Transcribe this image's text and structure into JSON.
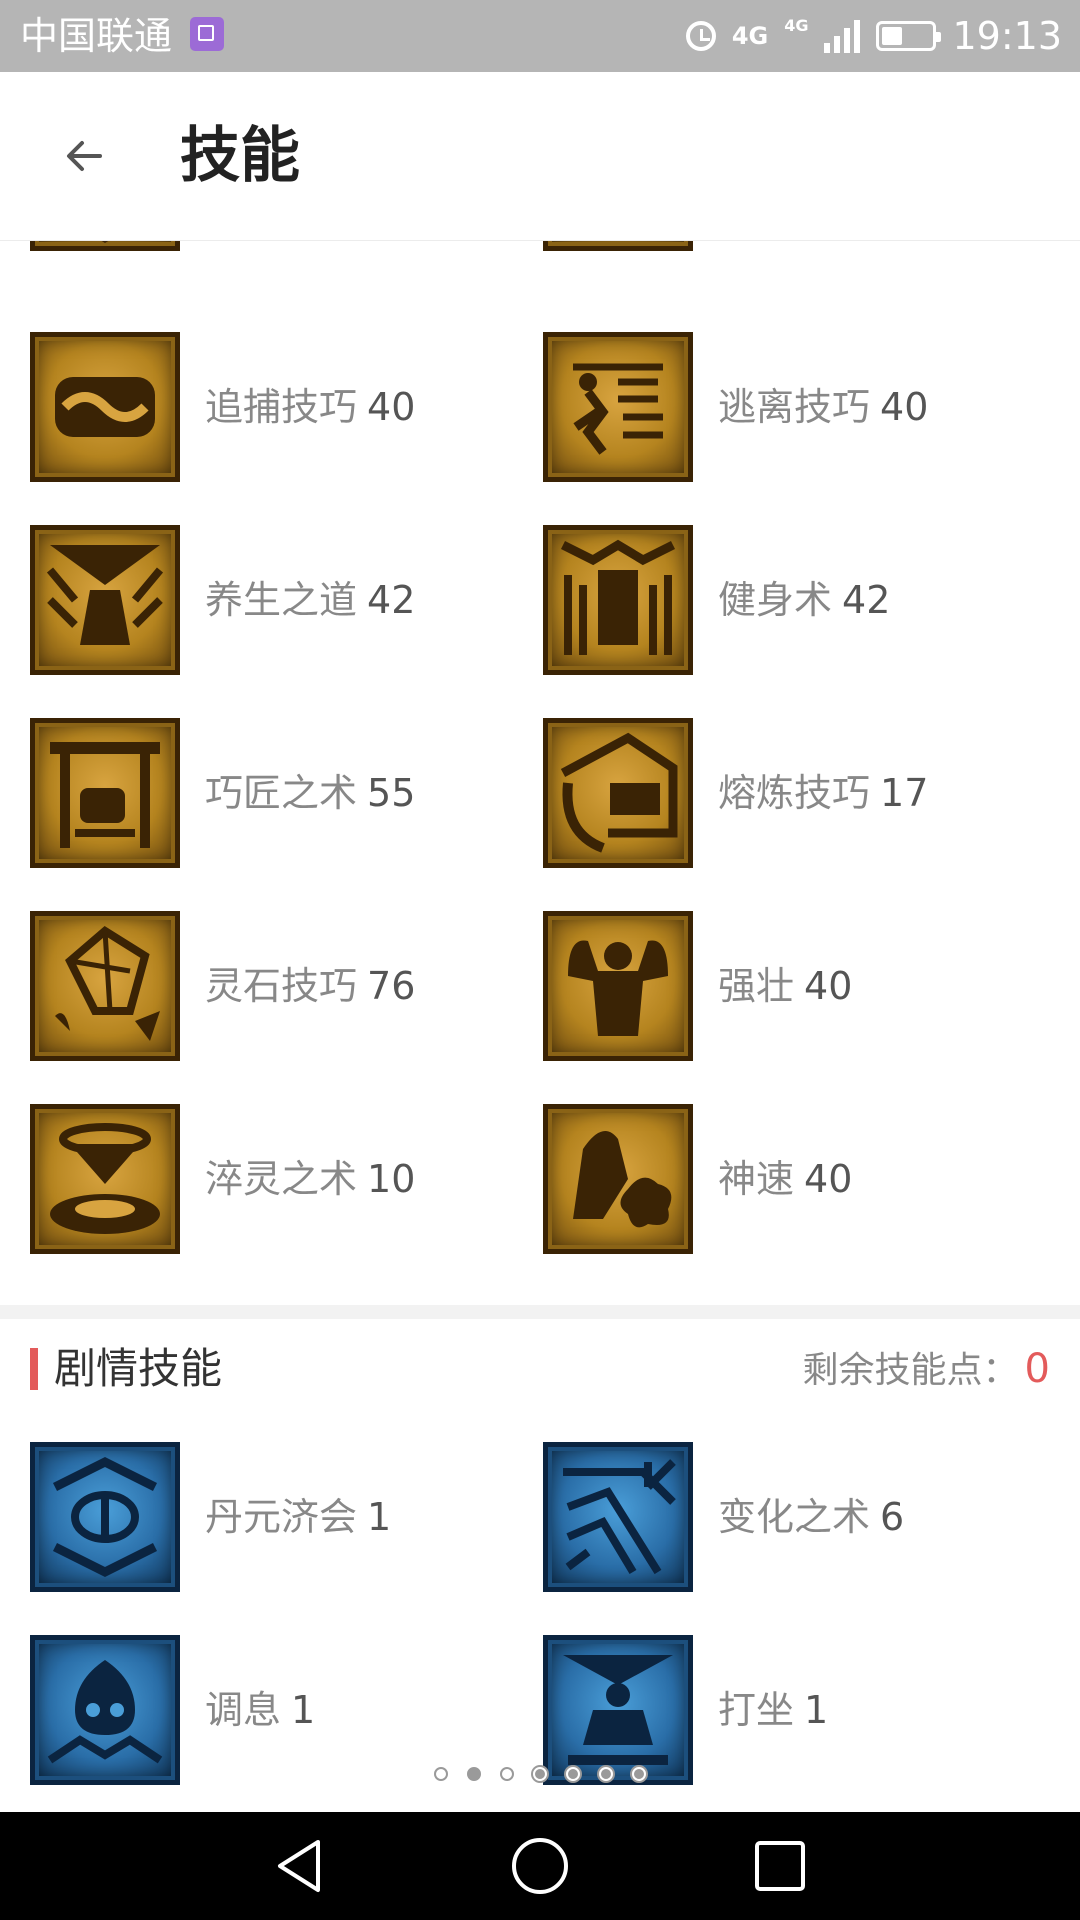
{
  "status_bar": {
    "carrier": "中国联通",
    "network_a": "4G",
    "network_b": "4G",
    "time": "19:13"
  },
  "header": {
    "title": "技能"
  },
  "life_skills": [
    {
      "name": "追捕技巧",
      "level": "40",
      "icon": "chase-icon"
    },
    {
      "name": "逃离技巧",
      "level": "40",
      "icon": "escape-icon"
    },
    {
      "name": "养生之道",
      "level": "42",
      "icon": "health-icon"
    },
    {
      "name": "健身术",
      "level": "42",
      "icon": "fitness-icon"
    },
    {
      "name": "巧匠之术",
      "level": "55",
      "icon": "craftsman-icon"
    },
    {
      "name": "熔炼技巧",
      "level": "17",
      "icon": "smelting-icon"
    },
    {
      "name": "灵石技巧",
      "level": "76",
      "icon": "spirit-stone-icon"
    },
    {
      "name": "强壮",
      "level": "40",
      "icon": "strong-icon"
    },
    {
      "name": "淬灵之术",
      "level": "10",
      "icon": "quench-icon"
    },
    {
      "name": "神速",
      "level": "40",
      "icon": "speed-icon"
    }
  ],
  "story_section": {
    "title": "剧情技能",
    "points_label": "剩余技能点：",
    "points_value": "0"
  },
  "story_skills": [
    {
      "name": "丹元济会",
      "level": "1",
      "icon": "elixir-icon"
    },
    {
      "name": "变化之术",
      "level": "6",
      "icon": "transform-icon"
    },
    {
      "name": "调息",
      "level": "1",
      "icon": "breathe-icon"
    },
    {
      "name": "打坐",
      "level": "1",
      "icon": "meditate-icon"
    }
  ],
  "pager": {
    "count": 7,
    "active_index": 1
  },
  "colors": {
    "accent": "#e35b5b",
    "gold": "#b5841f",
    "blue": "#2a6ea8"
  }
}
